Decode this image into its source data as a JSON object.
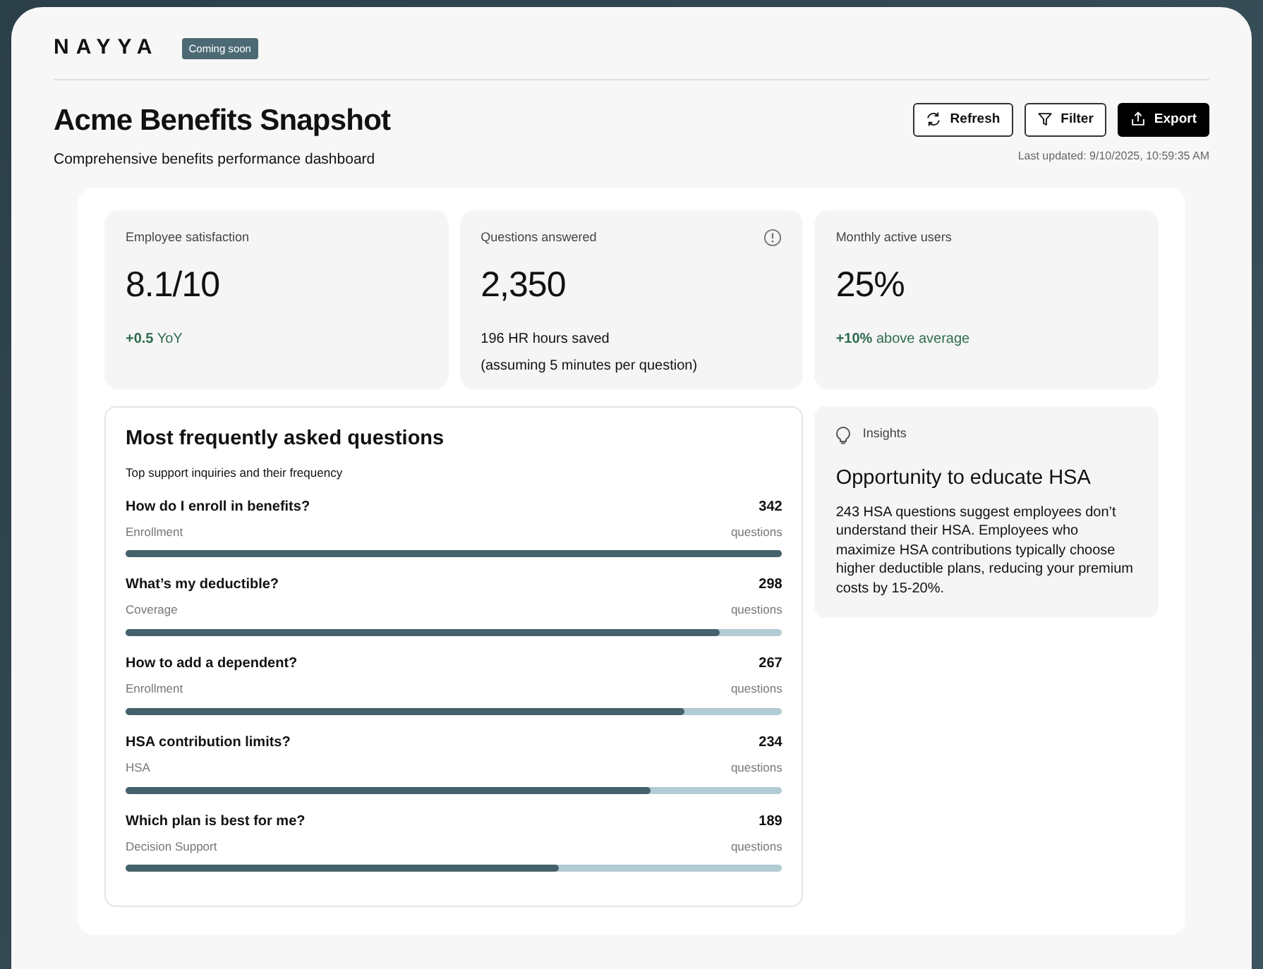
{
  "brand": {
    "logo": "NAYYA",
    "badge": "Coming soon"
  },
  "header": {
    "title": "Acme Benefits Snapshot",
    "subtitle": "Comprehensive benefits performance dashboard",
    "last_updated": "Last updated: 9/10/2025, 10:59:35 AM",
    "buttons": [
      {
        "label": "Refresh",
        "kind": "refresh",
        "primary": false
      },
      {
        "label": "Filter",
        "kind": "filter",
        "primary": false
      },
      {
        "label": "Export",
        "kind": "export",
        "primary": true
      }
    ]
  },
  "stats": [
    {
      "label": "Employee satisfaction",
      "value": "8.1/10",
      "note": "**+0.5** YoY",
      "kind": "trend",
      "info": false
    },
    {
      "label": "Questions answered",
      "value": "2,350",
      "note": "196 HR hours saved",
      "note2": "(assuming 5 minutes per question)",
      "kind": "plain",
      "info": true
    },
    {
      "label": "Monthly active users",
      "value": "25%",
      "note": "**+10%** above average",
      "kind": "trend",
      "info": false
    }
  ],
  "faq": {
    "title": "Most frequently asked questions",
    "subtitle": "Top support inquiries and their frequency",
    "items": [
      {
        "question": "How do I enroll in benefits?",
        "category": "Enrollment",
        "count": "342",
        "unit": "questions",
        "level": 1.0
      },
      {
        "question": "What’s my deductible?",
        "category": "Coverage",
        "count": "298",
        "unit": "questions",
        "level": 0.905
      },
      {
        "question": "How to add a dependent?",
        "category": "Enrollment",
        "count": "267",
        "unit": "questions",
        "level": 0.85
      },
      {
        "question": "HSA contribution limits?",
        "category": "HSA",
        "count": "234",
        "unit": "questions",
        "level": 0.8
      },
      {
        "question": "Which plan is best for me?",
        "category": "Decision Support",
        "count": "189",
        "unit": "questions",
        "level": 0.66
      }
    ]
  },
  "insight": {
    "label": "Insights",
    "title": "Opportunity to educate HSA",
    "body": "243 HSA questions suggest employees don’t understand their HSA. Employees who maximize HSA contributions typically choose higher deductible plans, reducing your premium costs by 15-20%."
  }
}
